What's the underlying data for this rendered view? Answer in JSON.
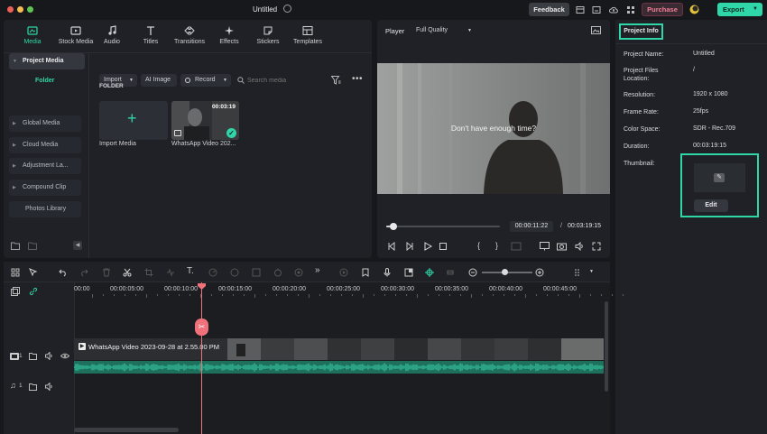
{
  "window": {
    "title": "Untitled"
  },
  "topbar": {
    "feedback": "Feedback",
    "purchase": "Purchase",
    "export": "Export"
  },
  "media_tabs": [
    {
      "label": "Media",
      "icon": "media-icon",
      "active": true
    },
    {
      "label": "Stock Media",
      "icon": "stock-media-icon"
    },
    {
      "label": "Audio",
      "icon": "music-note-icon"
    },
    {
      "label": "Titles",
      "icon": "text-t-icon"
    },
    {
      "label": "Transitions",
      "icon": "transitions-icon"
    },
    {
      "label": "Effects",
      "icon": "effects-icon"
    },
    {
      "label": "Stickers",
      "icon": "stickers-icon"
    },
    {
      "label": "Templates",
      "icon": "templates-icon"
    }
  ],
  "sidebar": {
    "items": [
      {
        "label": "Project Media",
        "active": true
      },
      {
        "label": "Folder"
      },
      {
        "label": "Global Media"
      },
      {
        "label": "Cloud Media"
      },
      {
        "label": "Adjustment La..."
      },
      {
        "label": "Compound Clip"
      },
      {
        "label": "Photos Library"
      }
    ]
  },
  "media_toolbar": {
    "import": "Import",
    "ai_image": "AI Image",
    "record": "Record",
    "search_placeholder": "Search media"
  },
  "media_area": {
    "folder_heading": "FOLDER",
    "import_label": "Import Media",
    "clip_label": "WhatsApp Video 202...",
    "clip_duration": "00:03:19"
  },
  "player": {
    "label": "Player",
    "quality": "Full Quality",
    "caption": "Don't have enough time?",
    "current_time": "00:00:11:22",
    "total_time": "00:03:19:15",
    "progress": 0.06
  },
  "project_info": {
    "tab": "Project Info",
    "rows": [
      {
        "label": "Project Name:",
        "value": "Untitled"
      },
      {
        "label": "Project Files Location:",
        "value": "/"
      },
      {
        "label": "Resolution:",
        "value": "1920 x 1080"
      },
      {
        "label": "Frame Rate:",
        "value": "25fps"
      },
      {
        "label": "Color Space:",
        "value": "SDR - Rec.709"
      },
      {
        "label": "Duration:",
        "value": "00:03:19:15"
      },
      {
        "label": "Thumbnail:",
        "value": ""
      }
    ],
    "edit_button": "Edit",
    "accent_color": "#2fd6a8"
  },
  "timeline": {
    "ruler": [
      "00:00",
      "00:00:05:00",
      "00:00:10:00",
      "00:00:15:00",
      "00:00:20:00",
      "00:00:25:00",
      "00:00:30:00",
      "00:00:35:00",
      "00:00:40:00",
      "00:00:45:00"
    ],
    "clip_title": "WhatsApp Video 2023-09-28 at 2.55.00 PM",
    "video_track_num": "1",
    "audio_track_num": "1",
    "zoom": 0.45
  }
}
